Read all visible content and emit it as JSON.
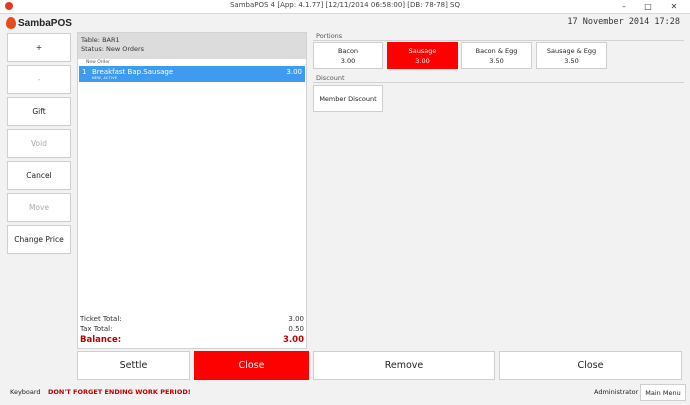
{
  "window": {
    "title": "SambaPOS 4 [App: 4.1.77] [12/11/2014 06:58:00] [DB: 78-78] SQ",
    "minimize": "–",
    "maximize": "□",
    "close": "✕"
  },
  "brand": {
    "name": "SambaPOS"
  },
  "clock": "17 November 2014 17:28",
  "commands": [
    {
      "label": "+"
    },
    {
      "label": "-"
    },
    {
      "label": "Gift"
    },
    {
      "label": "Void"
    },
    {
      "label": "Cancel"
    },
    {
      "label": "Move"
    },
    {
      "label": "Change Price"
    }
  ],
  "ticket": {
    "table": "Table: BAR1",
    "status": "Status: New Orders",
    "section_header": "New Order",
    "orders": [
      {
        "qty": "1",
        "name": "Breakfast Bap.Sausage",
        "price": "3.00",
        "states": "NEW, ACTIVE"
      }
    ],
    "ticket_total_label": "Ticket Total:",
    "ticket_total": "3.00",
    "tax_total_label": "Tax Total:",
    "tax_total": "0.50",
    "balance_label": "Balance:",
    "balance": "3.00"
  },
  "portions": {
    "title": "Portions",
    "items": [
      {
        "name": "Bacon",
        "price": "3.00"
      },
      {
        "name": "Sausage",
        "price": "3.00"
      },
      {
        "name": "Bacon & Egg",
        "price": "3.50"
      },
      {
        "name": "Sausage & Egg",
        "price": "3.50"
      }
    ],
    "selected": "Sausage"
  },
  "discount": {
    "title": "Discount",
    "items": [
      {
        "name": "Member Discount"
      }
    ]
  },
  "actions": {
    "settle": "Settle",
    "close_ticket": "Close",
    "remove": "Remove",
    "close": "Close"
  },
  "statusbar": {
    "keyboard": "Keyboard",
    "warning": "DON'T FORGET ENDING WORK PERIOD!",
    "user": "Administrator",
    "main_menu": "Main Menu"
  },
  "colors": {
    "accent_red": "#ff0000",
    "selected_line": "#3d9bf0",
    "balance_red": "#c00000"
  }
}
